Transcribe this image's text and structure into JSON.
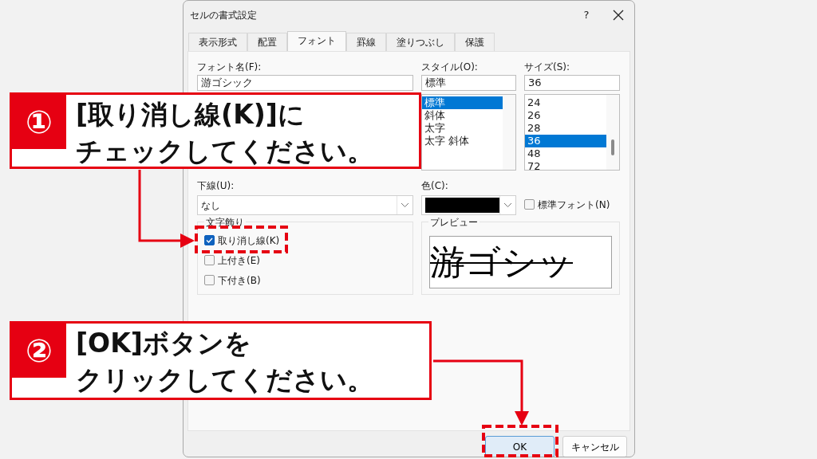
{
  "window": {
    "title": "セルの書式設定",
    "help": "?"
  },
  "tabs": [
    {
      "label": "表示形式",
      "selected": false
    },
    {
      "label": "配置",
      "selected": false
    },
    {
      "label": "フォント",
      "selected": true
    },
    {
      "label": "罫線",
      "selected": false
    },
    {
      "label": "塗りつぶし",
      "selected": false
    },
    {
      "label": "保護",
      "selected": false
    }
  ],
  "font_name": {
    "label": "フォント名(F):",
    "value": "游ゴシック"
  },
  "style": {
    "label": "スタイル(O):",
    "value": "標準",
    "items": [
      {
        "label": "標準",
        "selected": true
      },
      {
        "label": "斜体",
        "selected": false
      },
      {
        "label": "太字",
        "selected": false
      },
      {
        "label": "太字 斜体",
        "selected": false
      }
    ]
  },
  "size": {
    "label": "サイズ(S):",
    "value": "36",
    "items": [
      {
        "label": "24",
        "selected": false
      },
      {
        "label": "26",
        "selected": false
      },
      {
        "label": "28",
        "selected": false
      },
      {
        "label": "36",
        "selected": true
      },
      {
        "label": "48",
        "selected": false
      },
      {
        "label": "72",
        "selected": false
      }
    ]
  },
  "underline": {
    "label": "下線(U):",
    "value": "なし"
  },
  "color": {
    "label": "色(C):"
  },
  "normal_font": {
    "label": "標準フォント(N)",
    "checked": false
  },
  "effects": {
    "title": "文字飾り",
    "options": [
      {
        "label": "取り消し線(K)",
        "checked": true
      },
      {
        "label": "上付き(E)",
        "checked": false
      },
      {
        "label": "下付き(B)",
        "checked": false
      }
    ]
  },
  "preview": {
    "title": "プレビュー",
    "sample": "游ゴシッ",
    "strikethrough": true
  },
  "buttons": [
    {
      "label": "OK",
      "default": true
    },
    {
      "label": "キャンセル",
      "default": false
    }
  ],
  "callouts": [
    {
      "number": "①",
      "lines": [
        "[取り消し線(K)]に",
        "チェックしてください。"
      ]
    },
    {
      "number": "②",
      "lines": [
        "[OK]ボタンを",
        "クリックしてください。"
      ]
    }
  ]
}
